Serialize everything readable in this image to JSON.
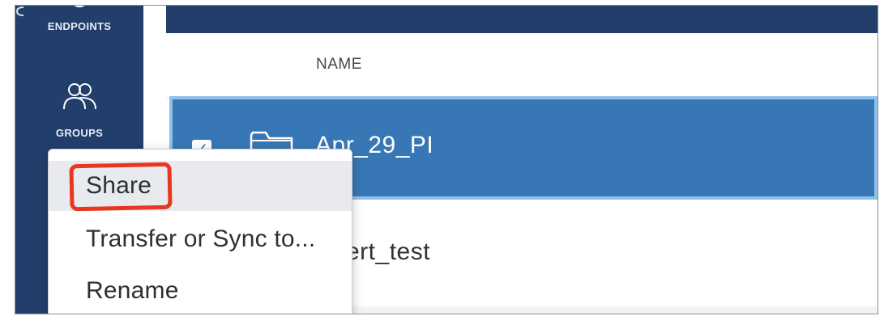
{
  "sidebar": {
    "items": [
      {
        "label": "ENDPOINTS",
        "icon": "endpoints-icon"
      },
      {
        "label": "GROUPS",
        "icon": "groups-icon"
      }
    ]
  },
  "table": {
    "header": {
      "name_col": "NAME"
    },
    "rows": [
      {
        "name": "Apr_29_PI",
        "selected": true,
        "icon": "folder-icon"
      },
      {
        "name": "ert_test",
        "selected": false
      }
    ]
  },
  "context_menu": {
    "items": [
      {
        "label": "Share",
        "highlighted": true
      },
      {
        "label": "Transfer or Sync to..."
      },
      {
        "label": "Rename"
      }
    ]
  },
  "colors": {
    "nav_bg": "#223f6b",
    "selected_row": "#3877b5",
    "selected_border": "#8fc0ea",
    "annotation": "#e8361f"
  }
}
